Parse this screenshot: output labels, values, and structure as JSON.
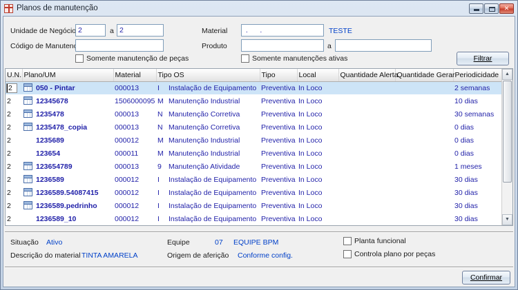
{
  "window": {
    "title": "Planos de manutenção"
  },
  "colors": {
    "selected_row": "#cde4f7",
    "grid_text": "#1f1fa8",
    "link_text": "#0040c8",
    "close_button": "#c43a28"
  },
  "filters": {
    "un_label": "Unidade de Negócio",
    "un_from": "2",
    "range_sep": "a",
    "un_to": "2",
    "material_label": "Material",
    "material_value": " .      .",
    "material_desc": "TESTE",
    "codigo_label": "Código de Manutenção",
    "codigo_value": "",
    "produto_label": "Produto",
    "produto_from": "",
    "produto_sep": "a",
    "produto_to": "",
    "chk_pecas": "Somente manutenção de peças",
    "chk_ativas": "Somente manutenções ativas",
    "filtrar": "Filtrar"
  },
  "grid": {
    "columns": [
      "U.N.",
      "Plano/UM",
      "Material",
      "Tipo OS",
      "Tipo",
      "Local",
      "Quantidade Alerta",
      "Quantidade Gerar",
      "Periodicidade"
    ],
    "rows": [
      {
        "un": "2",
        "icon": true,
        "plano": "050 - Pintar",
        "material": "000013",
        "os_code": "I",
        "os_desc": "Instalação de Equipamento",
        "tipo": "Preventiva",
        "local": "In Loco",
        "qtd_alerta": "",
        "qtd_gerar": "",
        "period": "2 semanas",
        "selected": true
      },
      {
        "un": "2",
        "icon": true,
        "plano": "12345678",
        "material": "1506000095",
        "os_code": "M",
        "os_desc": "Manutenção Industrial",
        "tipo": "Preventiva",
        "local": "In Loco",
        "qtd_alerta": "",
        "qtd_gerar": "",
        "period": "10 dias",
        "selected": false
      },
      {
        "un": "2",
        "icon": true,
        "plano": "1235478",
        "material": "000013",
        "os_code": "N",
        "os_desc": "Manutenção Corretiva",
        "tipo": "Preventiva",
        "local": "In Loco",
        "qtd_alerta": "",
        "qtd_gerar": "",
        "period": "30 semanas",
        "selected": false
      },
      {
        "un": "2",
        "icon": true,
        "plano": "1235478_copia",
        "material": "000013",
        "os_code": "N",
        "os_desc": "Manutenção Corretiva",
        "tipo": "Preventiva",
        "local": "In Loco",
        "qtd_alerta": "",
        "qtd_gerar": "",
        "period": "0 dias",
        "selected": false
      },
      {
        "un": "2",
        "icon": false,
        "plano": "1235689",
        "material": "000012",
        "os_code": "M",
        "os_desc": "Manutenção Industrial",
        "tipo": "Preventiva",
        "local": "In Loco",
        "qtd_alerta": "",
        "qtd_gerar": "",
        "period": "0 dias",
        "selected": false
      },
      {
        "un": "2",
        "icon": false,
        "plano": "123654",
        "material": "000011",
        "os_code": "M",
        "os_desc": "Manutenção Industrial",
        "tipo": "Preventiva",
        "local": "In Loco",
        "qtd_alerta": "",
        "qtd_gerar": "",
        "period": "0 dias",
        "selected": false
      },
      {
        "un": "2",
        "icon": true,
        "plano": "123654789",
        "material": "000013",
        "os_code": "9",
        "os_desc": "Manutenção Atividade",
        "tipo": "Preventiva",
        "local": "In Loco",
        "qtd_alerta": "",
        "qtd_gerar": "",
        "period": "1 meses",
        "selected": false
      },
      {
        "un": "2",
        "icon": true,
        "plano": "1236589",
        "material": "000012",
        "os_code": "I",
        "os_desc": "Instalação de Equipamento",
        "tipo": "Preventiva",
        "local": "In Loco",
        "qtd_alerta": "",
        "qtd_gerar": "",
        "period": "30 dias",
        "selected": false
      },
      {
        "un": "2",
        "icon": true,
        "plano": "1236589.54087415",
        "material": "000012",
        "os_code": "I",
        "os_desc": "Instalação de Equipamento",
        "tipo": "Preventiva",
        "local": "In Loco",
        "qtd_alerta": "",
        "qtd_gerar": "",
        "period": "30 dias",
        "selected": false
      },
      {
        "un": "2",
        "icon": true,
        "plano": "1236589.pedrinho",
        "material": "000012",
        "os_code": "I",
        "os_desc": "Instalação de Equipamento",
        "tipo": "Preventiva",
        "local": "In Loco",
        "qtd_alerta": "",
        "qtd_gerar": "",
        "period": "30 dias",
        "selected": false
      },
      {
        "un": "2",
        "icon": false,
        "plano": "1236589_10",
        "material": "000012",
        "os_code": "I",
        "os_desc": "Instalação de Equipamento",
        "tipo": "Preventiva",
        "local": "In Loco",
        "qtd_alerta": "",
        "qtd_gerar": "",
        "period": "30 dias",
        "selected": false
      }
    ]
  },
  "details": {
    "situacao_label": "Situação",
    "situacao_value": "Ativo",
    "equipe_label": "Equipe",
    "equipe_code": "07",
    "equipe_value": "EQUIPE BPM",
    "descricao_label": "Descrição do material",
    "descricao_value": "TINTA AMARELA",
    "origem_label": "Origem de aferição",
    "origem_value": "Conforme config.",
    "chk_planta": "Planta funcional",
    "chk_controla": "Controla plano por peças"
  },
  "footer": {
    "confirmar": "Confirmar"
  }
}
